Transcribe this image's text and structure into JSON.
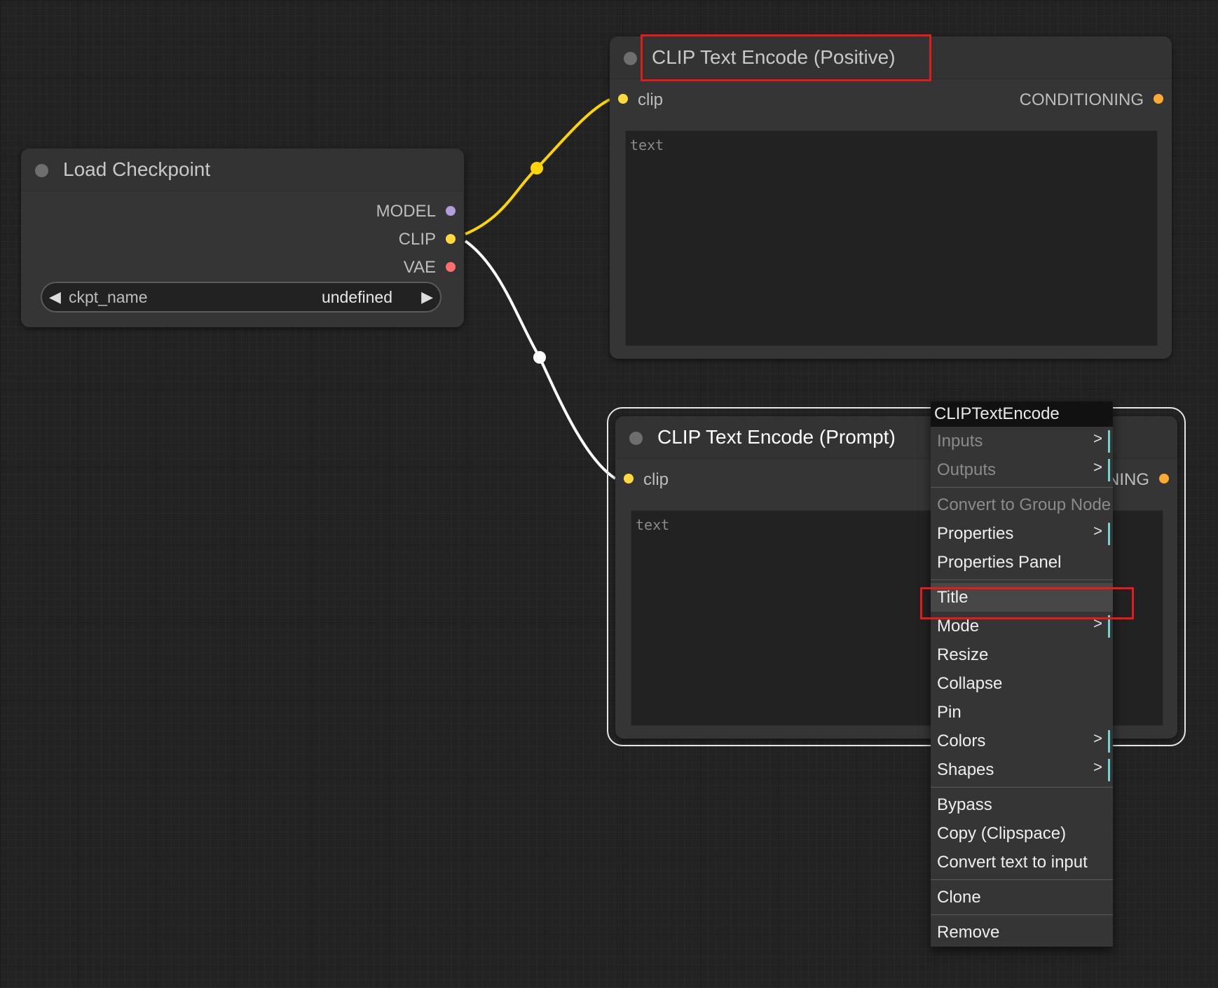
{
  "colors": {
    "clip_link": "#ffd500",
    "clip_slot": "#ffd93d",
    "model_slot": "#b39ddb",
    "vae_slot": "#ff6e6e",
    "conditioning_slot": "#ffa931",
    "highlight_box": "#e21b1b",
    "submenu_marker": "#6fd6d6"
  },
  "nodes": {
    "load_checkpoint": {
      "title": "Load Checkpoint",
      "outputs": [
        "MODEL",
        "CLIP",
        "VAE"
      ],
      "widget": {
        "name": "ckpt_name",
        "value": "undefined",
        "prev_icon": "◀",
        "next_icon": "▶"
      }
    },
    "clip_positive": {
      "title": "CLIP Text Encode (Positive)",
      "input": "clip",
      "output": "CONDITIONING",
      "text_placeholder": "text"
    },
    "clip_prompt": {
      "title": "CLIP Text Encode (Prompt)",
      "input": "clip",
      "output_visible": "NING",
      "text_placeholder": "text"
    }
  },
  "context_menu": {
    "title": "CLIPTextEncode",
    "items": [
      {
        "label": "Inputs",
        "submenu": true,
        "disabled": true
      },
      {
        "label": "Outputs",
        "submenu": true,
        "disabled": true
      },
      {
        "separator": true
      },
      {
        "label": "Convert to Group Node",
        "disabled": true
      },
      {
        "label": "Properties",
        "submenu": true
      },
      {
        "label": "Properties Panel"
      },
      {
        "separator": true
      },
      {
        "label": "Title",
        "highlighted": true
      },
      {
        "label": "Mode",
        "submenu": true
      },
      {
        "label": "Resize"
      },
      {
        "label": "Collapse"
      },
      {
        "label": "Pin"
      },
      {
        "label": "Colors",
        "submenu": true
      },
      {
        "label": "Shapes",
        "submenu": true
      },
      {
        "separator": true
      },
      {
        "label": "Bypass"
      },
      {
        "label": "Copy (Clipspace)"
      },
      {
        "label": "Convert text to input"
      },
      {
        "separator": true
      },
      {
        "label": "Clone"
      },
      {
        "separator": true
      },
      {
        "label": "Remove"
      }
    ],
    "submenu_arrow": ">"
  }
}
